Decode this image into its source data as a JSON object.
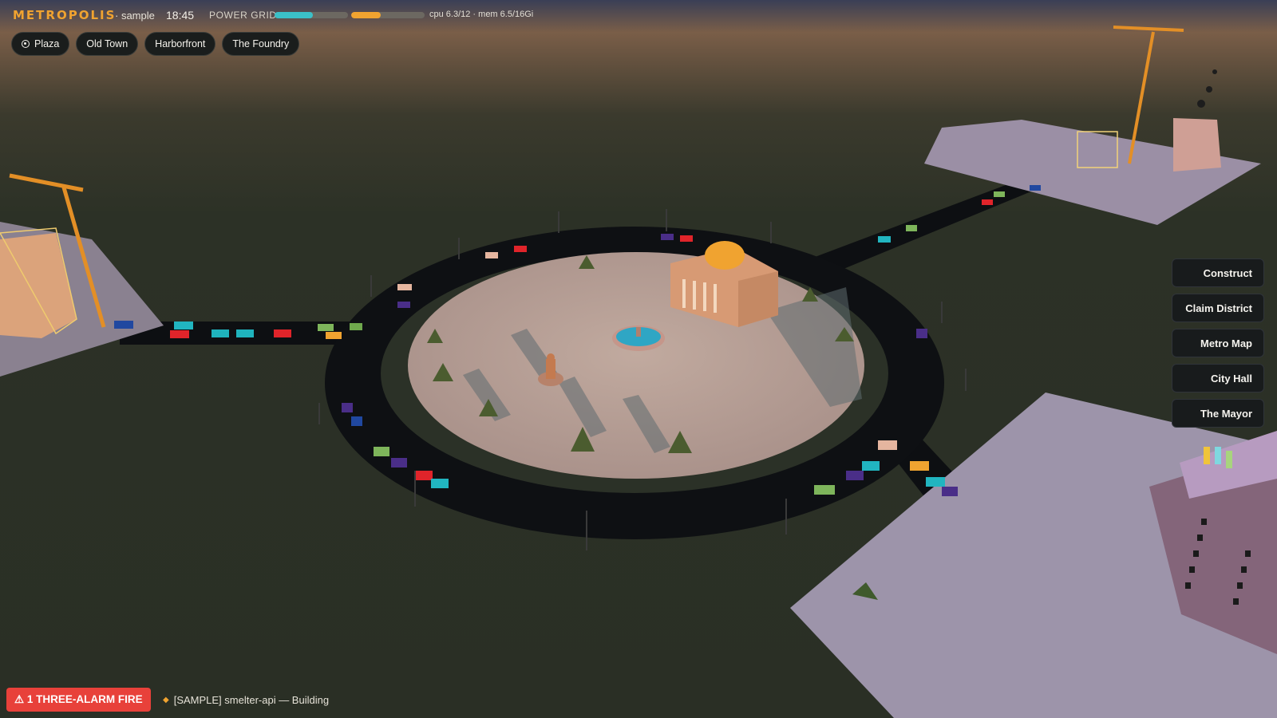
{
  "app": {
    "title": "METROPOLIS",
    "mode": "· sample",
    "time": "18:45",
    "power_grid_label": "POWER GRID",
    "cpu_fraction": 0.525,
    "mem_fraction": 0.406,
    "stats": "cpu 6.3/12 · mem 6.5/16Gi"
  },
  "districts": [
    {
      "label": "Plaza",
      "selected": true
    },
    {
      "label": "Old Town",
      "selected": false
    },
    {
      "label": "Harborfront",
      "selected": false
    },
    {
      "label": "The Foundry",
      "selected": false
    }
  ],
  "menu": {
    "construct": "Construct",
    "claim_district": "Claim District",
    "metro_map": "Metro Map",
    "city_hall": "City Hall",
    "the_mayor": "The Mayor"
  },
  "alert": {
    "label": "⚠ 1 THREE-ALARM FIRE",
    "ticker": "[SAMPLE] smelter-api — Building"
  },
  "colors": {
    "accent": "#f0a330",
    "cpu_bar": "#3bc0c8",
    "mem_bar": "#f0a330",
    "alert": "#e8413a",
    "ground": "#2b3025",
    "road": "#0e1013",
    "plaza": "#b9a49a"
  },
  "icons": {
    "radio": "radio-selected-icon",
    "warning": "warning-icon",
    "ticker": "diamond-icon"
  }
}
